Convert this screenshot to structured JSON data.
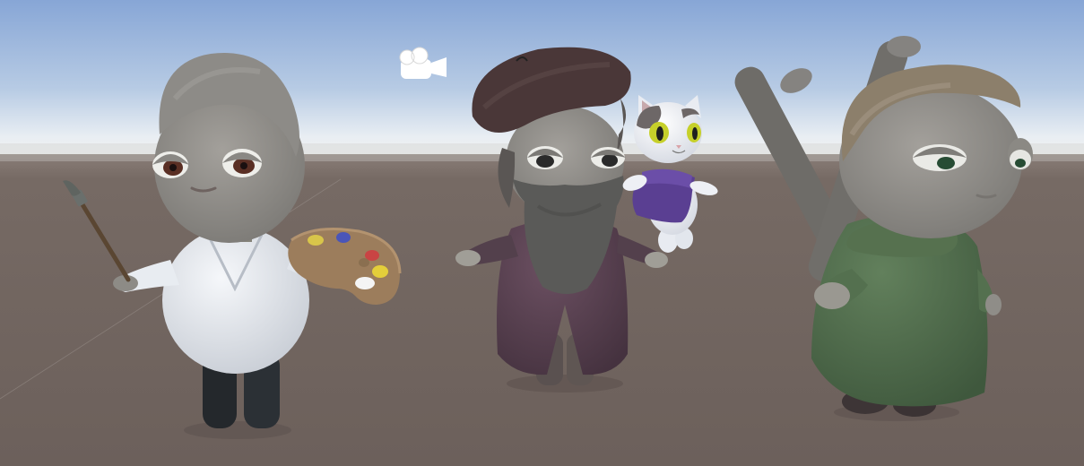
{
  "scene": {
    "view": "scene-view",
    "camera_gizmo_icon": "camera-icon",
    "colors": {
      "sky_top": "#8fb0dc",
      "sky_horizon": "#e9eef3",
      "ground": "#6e625d",
      "ground_far": "#80746e",
      "skin": "#8f8d88",
      "painter_shirt": "#e4e8ee",
      "painter_pants": "#24282c",
      "wizard_robe": "#56404e",
      "wizard_beret": "#4a3738",
      "beard": "#5a5a58",
      "scarf": "#5a3f92",
      "cat_white": "#eef0f5",
      "cat_eyes": "#c6d02a",
      "monk_robe": "#4f6b4c",
      "monk_hat": "#8c7f6b",
      "logs": "#6e6c68",
      "palette": "#9c7d5c"
    },
    "palette_paint_colors": [
      "#d8c54a",
      "#4a55b8",
      "#c94444",
      "#e4ce3a",
      "#f4f4f4",
      "#5aa25a"
    ],
    "characters": [
      {
        "id": "painter",
        "props": [
          "paintbrush",
          "palette"
        ]
      },
      {
        "id": "wizard",
        "props": [
          "beret",
          "beard",
          "cat"
        ]
      },
      {
        "id": "monk",
        "props": [
          "logs"
        ]
      }
    ]
  }
}
